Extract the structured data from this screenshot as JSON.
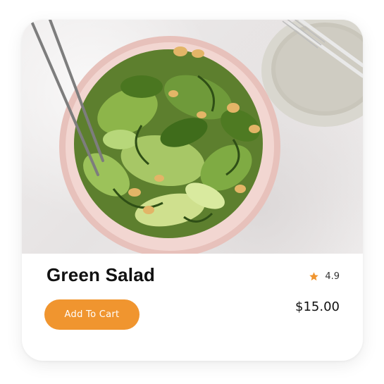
{
  "product": {
    "name": "Green Salad",
    "rating": "4.9",
    "price": "$15.00",
    "image_alt": "green-salad-photo"
  },
  "actions": {
    "add_to_cart_label": "Add To Cart"
  },
  "icons": {
    "rating": "star-icon"
  },
  "colors": {
    "accent": "#f0952f",
    "title": "#111111",
    "card_bg": "#ffffff",
    "star": "#f0952f"
  }
}
